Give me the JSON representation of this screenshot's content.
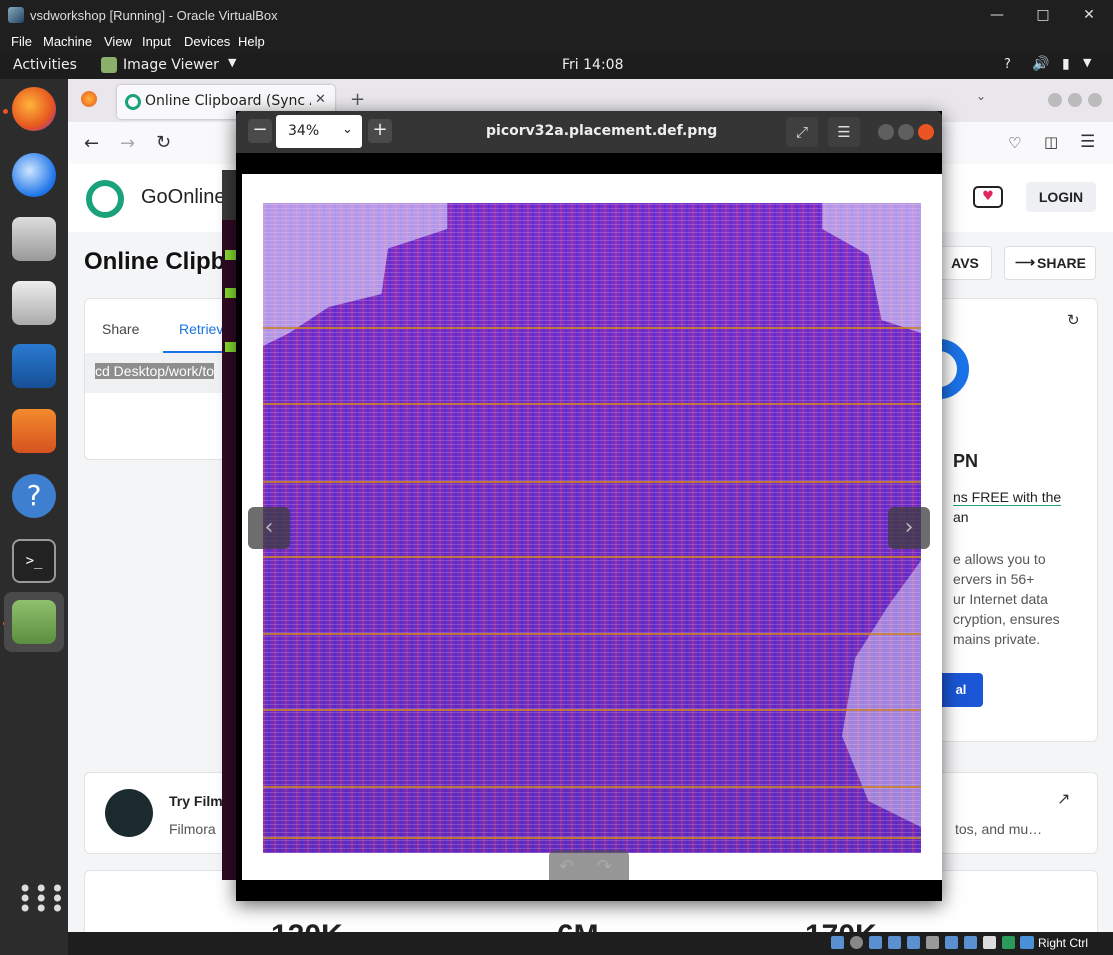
{
  "vbox": {
    "title": "vsdworkshop [Running] - Oracle VirtualBox",
    "menu": [
      "File",
      "Machine",
      "View",
      "Input",
      "Devices",
      "Help"
    ],
    "host_key": "Right Ctrl"
  },
  "topbar": {
    "activities": "Activities",
    "app_name": "Image Viewer",
    "clock": "Fri 14:08"
  },
  "firefox": {
    "tab_title": "Online Clipboard (Sync A",
    "site_name": "GoOnline",
    "login": "LOGIN",
    "page_heading": "Online Clipbo",
    "tab_share": "Share",
    "tab_retrieve": "Retriev",
    "clip_text": "cd Desktop/work/to",
    "avs_button": "AVS",
    "share_button": "SHARE",
    "vpn_title": "PN",
    "vpn_link": "ns FREE with the",
    "vpn_link2": "an",
    "vpn_body": [
      "e allows you to",
      "ervers in 56+",
      "ur Internet data",
      "cryption, ensures",
      "mains private."
    ],
    "vpn_cta": "al",
    "promo_title": "Try Film",
    "promo_sub": "Filmora",
    "promo_tail": "tos, and mu…",
    "stats_partial": [
      "120K",
      "6M",
      "170K"
    ]
  },
  "image_viewer": {
    "zoom": "34%",
    "filename": "picorv32a.placement.def.png"
  },
  "colors": {
    "ubuntu_orange": "#e95420",
    "accent_blue": "#1a73e8",
    "goonline_green": "#1aa37a"
  }
}
